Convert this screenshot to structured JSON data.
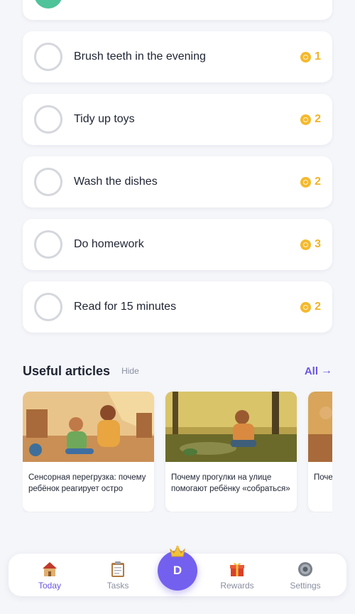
{
  "tasks": [
    {
      "label": "Brush teeth in the evening",
      "reward": "1"
    },
    {
      "label": "Tidy up toys",
      "reward": "2"
    },
    {
      "label": "Wash the dishes",
      "reward": "2"
    },
    {
      "label": "Do homework",
      "reward": "3"
    },
    {
      "label": "Read for 15 minutes",
      "reward": "2"
    }
  ],
  "articles": {
    "title": "Useful articles",
    "hide_label": "Hide",
    "all_label": "All",
    "items": [
      {
        "text": "Сенсорная перегрузка: почему ребёнок реагирует остро"
      },
      {
        "text": "Почему прогулки на улице помогают ребёнку «собраться»"
      },
      {
        "text": "Почему ребё"
      }
    ]
  },
  "nav": {
    "today": "Today",
    "tasks": "Tasks",
    "profile_initial": "D",
    "rewards": "Rewards",
    "settings": "Settings"
  },
  "colors": {
    "accent": "#6a55e0",
    "coin": "#f4b92e",
    "done": "#4fc39a",
    "background": "#f5f6fa"
  }
}
